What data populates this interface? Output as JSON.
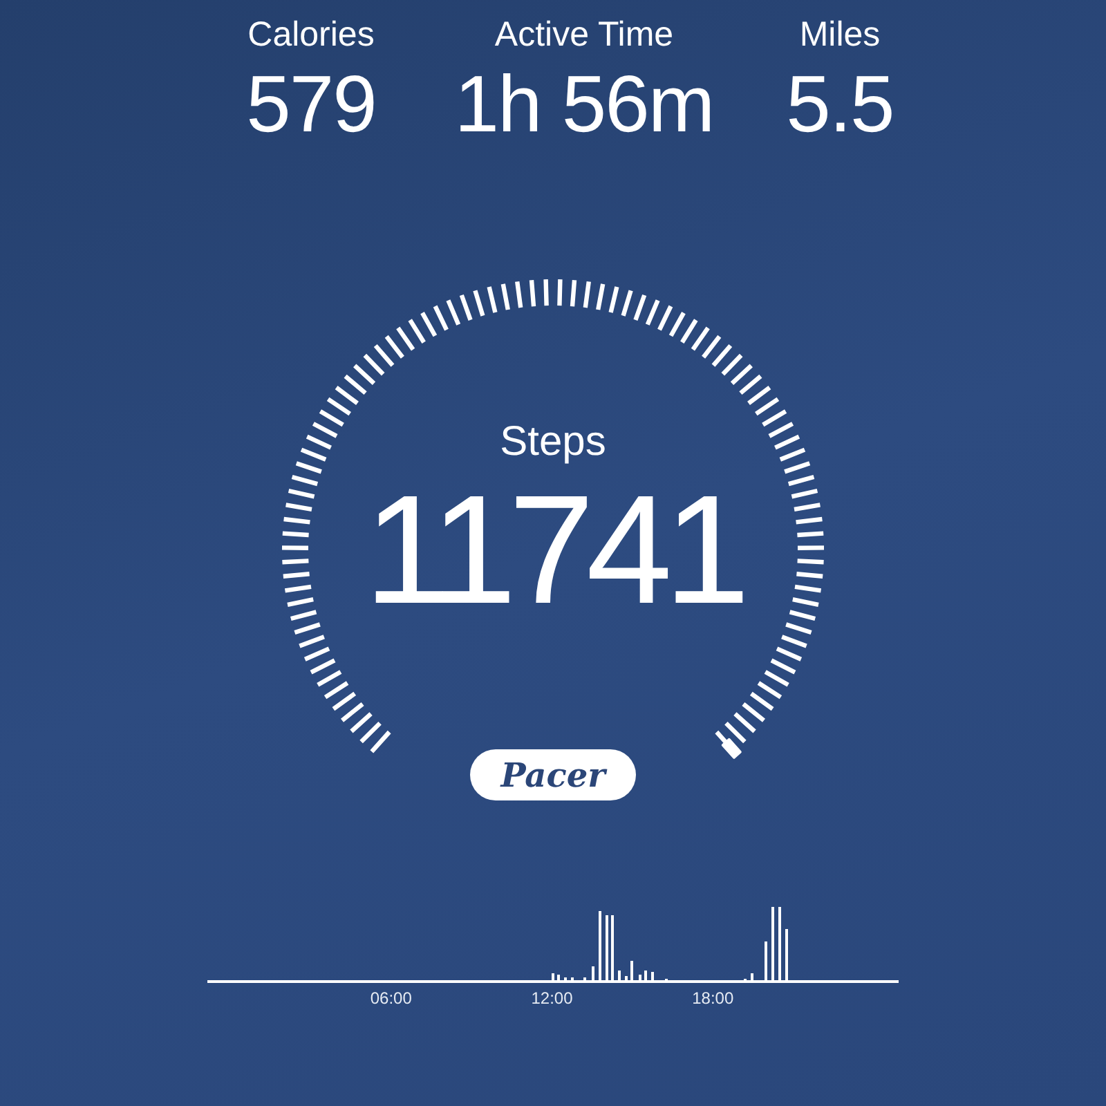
{
  "stats": [
    {
      "label": "Calories",
      "value": "579"
    },
    {
      "label": "Active Time",
      "value": "1h 56m"
    },
    {
      "label": "Miles",
      "value": "5.5"
    }
  ],
  "steps": {
    "label": "Steps",
    "value": "11741"
  },
  "brand": "Pacer",
  "activity_chart": {
    "time_labels": [
      "06:00",
      "12:00",
      "18:00"
    ]
  }
}
